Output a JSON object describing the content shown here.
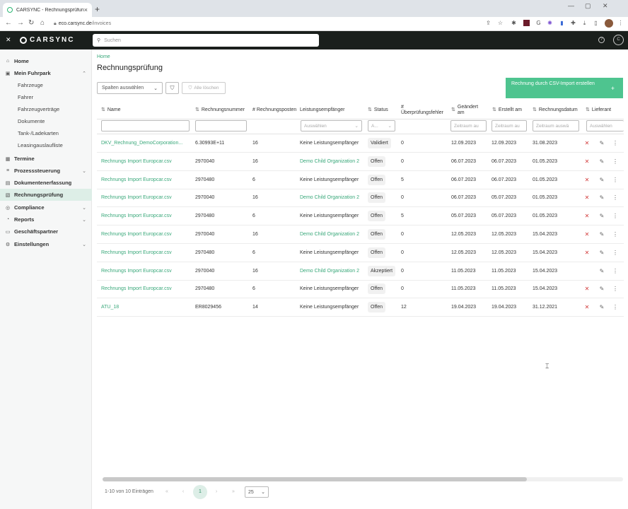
{
  "browser": {
    "tab_title": "CARSYNC - Rechnungsprüfung",
    "url_host": "eco.carsync.de",
    "url_path": "/invoices",
    "new_tab": "+",
    "close": "×"
  },
  "header": {
    "logo_text": "CARSYNC",
    "search_placeholder": "Suchen",
    "user_initials": "C",
    "help": "?"
  },
  "sidebar": {
    "items": [
      {
        "label": "Home",
        "icon": "home-icon",
        "glyph": "⌂",
        "bold": true,
        "sub": false,
        "active": false,
        "chevron": false
      },
      {
        "label": "Mein Fuhrpark",
        "icon": "car-icon",
        "glyph": "▣",
        "bold": true,
        "sub": false,
        "active": false,
        "chevron": true,
        "chev": "⌃"
      },
      {
        "label": "Fahrzeuge",
        "bold": false,
        "sub": true,
        "active": false,
        "chevron": false
      },
      {
        "label": "Fahrer",
        "bold": false,
        "sub": true,
        "active": false,
        "chevron": false
      },
      {
        "label": "Fahrzeugverträge",
        "bold": false,
        "sub": true,
        "active": false,
        "chevron": false
      },
      {
        "label": "Dokumente",
        "bold": false,
        "sub": true,
        "active": false,
        "chevron": false
      },
      {
        "label": "Tank-/Ladekarten",
        "bold": false,
        "sub": true,
        "active": false,
        "chevron": false
      },
      {
        "label": "Leasingauslaufliste",
        "bold": false,
        "sub": true,
        "active": false,
        "chevron": false
      },
      {
        "label": "Termine",
        "icon": "calendar-icon",
        "glyph": "▦",
        "bold": true,
        "sub": false,
        "active": false,
        "chevron": false
      },
      {
        "label": "Prozesssteuerung",
        "icon": "process-icon",
        "glyph": "≡",
        "bold": true,
        "sub": false,
        "active": false,
        "chevron": true,
        "chev": "⌄"
      },
      {
        "label": "Dokumentenerfassung",
        "icon": "document-icon",
        "glyph": "▤",
        "bold": true,
        "sub": false,
        "active": false,
        "chevron": false
      },
      {
        "label": "Rechnungsprüfung",
        "icon": "invoice-icon",
        "glyph": "▧",
        "bold": true,
        "sub": false,
        "active": true,
        "chevron": false
      },
      {
        "label": "Compliance",
        "icon": "compliance-icon",
        "glyph": "◎",
        "bold": true,
        "sub": false,
        "active": false,
        "chevron": true,
        "chev": "⌄"
      },
      {
        "label": "Reports",
        "icon": "reports-icon",
        "glyph": "◔",
        "bold": true,
        "sub": false,
        "active": false,
        "chevron": true,
        "chev": "⌄"
      },
      {
        "label": "Geschäftspartner",
        "icon": "partner-icon",
        "glyph": "▭",
        "bold": true,
        "sub": false,
        "active": false,
        "chevron": false
      },
      {
        "label": "Einstellungen",
        "icon": "settings-icon",
        "glyph": "⚙",
        "bold": true,
        "sub": false,
        "active": false,
        "chevron": true,
        "chev": "⌄"
      }
    ]
  },
  "main": {
    "breadcrumb": "Home",
    "title": "Rechnungsprüfung",
    "columns_select": "Spalten auswählen",
    "clear_filters": "Alle löschen",
    "import_button": "Rechnung durch CSV-Import erstellen",
    "import_plus": "+"
  },
  "table": {
    "headers": [
      {
        "label": "Name",
        "sortable": true
      },
      {
        "label": "Rechnungsnummer",
        "sortable": true
      },
      {
        "label": "# Rechnungsposten",
        "sortable": false
      },
      {
        "label": "Leistungsempfänger",
        "sortable": false
      },
      {
        "label": "Status",
        "sortable": true
      },
      {
        "label": "# Überprüfungsfehler",
        "sortable": false
      },
      {
        "label": "Geändert am",
        "sortable": true
      },
      {
        "label": "Erstellt am",
        "sortable": true
      },
      {
        "label": "Rechnungsdatum",
        "sortable": true
      },
      {
        "label": "Lieferant",
        "sortable": true
      }
    ],
    "filters": {
      "recipient_select": "Auswählen",
      "status_select": "A...",
      "changed_placeholder": "Zeitraum au",
      "created_placeholder": "Zeitraum au",
      "invoice_date_placeholder": "Zeitraum auswä",
      "supplier_select": "Auswählen"
    },
    "rows": [
      {
        "name": "DKV_Rechnung_DemoCorporation...",
        "number": "6.30993E+11",
        "positions": "16",
        "recipient": "Keine Leistungsempfänger",
        "recipient_link": false,
        "status": "Validiert",
        "errors": "0",
        "changed": "12.09.2023",
        "created": "12.09.2023",
        "invoice_date": "31.08.2023",
        "deletable": true
      },
      {
        "name": "Rechnungs Import Europcar.csv",
        "number": "2970040",
        "positions": "16",
        "recipient": "Demo Child Organization 2",
        "recipient_link": true,
        "status": "Offen",
        "errors": "0",
        "changed": "06.07.2023",
        "created": "06.07.2023",
        "invoice_date": "01.05.2023",
        "deletable": true
      },
      {
        "name": "Rechnungs Import Europcar.csv",
        "number": "2970480",
        "positions": "6",
        "recipient": "Keine Leistungsempfänger",
        "recipient_link": false,
        "status": "Offen",
        "errors": "5",
        "changed": "06.07.2023",
        "created": "06.07.2023",
        "invoice_date": "01.05.2023",
        "deletable": true
      },
      {
        "name": "Rechnungs Import Europcar.csv",
        "number": "2970040",
        "positions": "16",
        "recipient": "Demo Child Organization 2",
        "recipient_link": true,
        "status": "Offen",
        "errors": "0",
        "changed": "06.07.2023",
        "created": "05.07.2023",
        "invoice_date": "01.05.2023",
        "deletable": true
      },
      {
        "name": "Rechnungs Import Europcar.csv",
        "number": "2970480",
        "positions": "6",
        "recipient": "Keine Leistungsempfänger",
        "recipient_link": false,
        "status": "Offen",
        "errors": "5",
        "changed": "05.07.2023",
        "created": "05.07.2023",
        "invoice_date": "01.05.2023",
        "deletable": true
      },
      {
        "name": "Rechnungs Import Europcar.csv",
        "number": "2970040",
        "positions": "16",
        "recipient": "Demo Child Organization 2",
        "recipient_link": true,
        "status": "Offen",
        "errors": "0",
        "changed": "12.05.2023",
        "created": "12.05.2023",
        "invoice_date": "15.04.2023",
        "deletable": true
      },
      {
        "name": "Rechnungs Import Europcar.csv",
        "number": "2970480",
        "positions": "6",
        "recipient": "Keine Leistungsempfänger",
        "recipient_link": false,
        "status": "Offen",
        "errors": "0",
        "changed": "12.05.2023",
        "created": "12.05.2023",
        "invoice_date": "15.04.2023",
        "deletable": true
      },
      {
        "name": "Rechnungs Import Europcar.csv",
        "number": "2970040",
        "positions": "16",
        "recipient": "Demo Child Organization 2",
        "recipient_link": true,
        "status": "Akzeptiert",
        "errors": "0",
        "changed": "11.05.2023",
        "created": "11.05.2023",
        "invoice_date": "15.04.2023",
        "deletable": false
      },
      {
        "name": "Rechnungs Import Europcar.csv",
        "number": "2970480",
        "positions": "6",
        "recipient": "Keine Leistungsempfänger",
        "recipient_link": false,
        "status": "Offen",
        "errors": "0",
        "changed": "11.05.2023",
        "created": "11.05.2023",
        "invoice_date": "15.04.2023",
        "deletable": true
      },
      {
        "name": "ATU_18",
        "number": "ER8029456",
        "positions": "14",
        "recipient": "Keine Leistungsempfänger",
        "recipient_link": false,
        "status": "Offen",
        "errors": "12",
        "changed": "19.04.2023",
        "created": "19.04.2023",
        "invoice_date": "31.12.2021",
        "deletable": true
      }
    ],
    "icons": {
      "delete": "✕",
      "edit": "✎",
      "more": "⋮"
    }
  },
  "pagination": {
    "info": "1-10 von 10 Einträgen",
    "first": "«",
    "prev": "‹",
    "current_page": "1",
    "next": "›",
    "last": "»",
    "page_size": "25"
  },
  "colors": {
    "accent": "#4ec48f",
    "link": "#39a87a",
    "header_bg": "#1a1f1c",
    "delete": "#d23b3b"
  }
}
